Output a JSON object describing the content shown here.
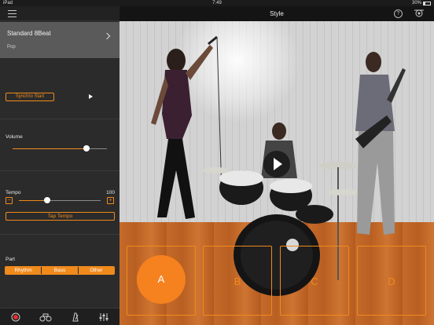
{
  "status_bar": {
    "carrier": "iPad",
    "time": "7:49",
    "battery": "30%"
  },
  "left_panel": {
    "style_card": {
      "name": "Standard 8Beat",
      "genre": "Pop"
    },
    "synchro_start_label": "Synchro Start",
    "volume": {
      "label": "Volume",
      "level_fraction": 0.78
    },
    "tempo": {
      "label": "Tempo",
      "value": "100",
      "level_fraction": 0.35,
      "minus_label": "−",
      "plus_label": "+"
    },
    "tap_tempo_label": "Tap Tempo",
    "part": {
      "label": "Part",
      "options": [
        "Rhythm",
        "Bass",
        "Other"
      ]
    },
    "toolbar_icons": [
      "record-icon",
      "style-icon",
      "metronome-icon",
      "mixer-icon"
    ]
  },
  "right_panel": {
    "title": "Style",
    "pads": [
      "A",
      "B",
      "C",
      "D"
    ],
    "active_pad": "A",
    "accent_color": "#f08a1c"
  }
}
